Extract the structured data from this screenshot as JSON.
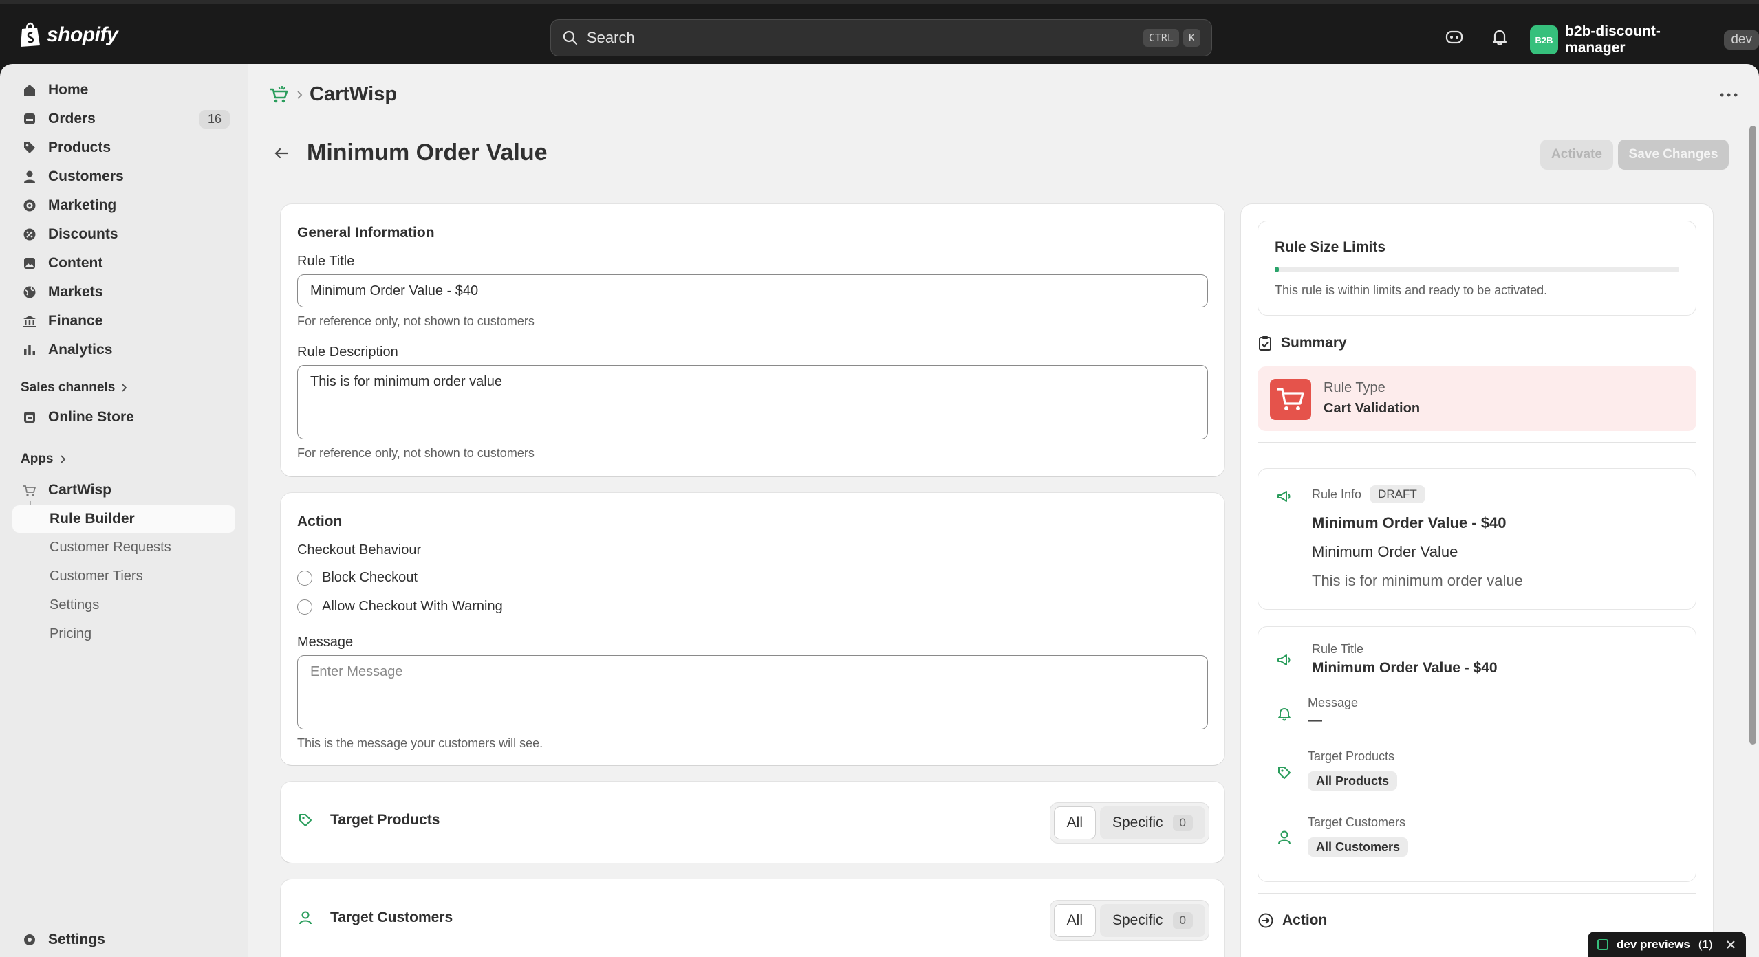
{
  "topbar": {
    "brand": "shopify",
    "search_placeholder": "Search",
    "kbd_ctrl": "CTRL",
    "kbd_k": "K",
    "store_avatar": "B2B",
    "store_name": "b2b-discount-manager",
    "store_badge": "dev"
  },
  "sidebar": {
    "items": [
      {
        "label": "Home",
        "icon": "home-icon"
      },
      {
        "label": "Orders",
        "icon": "orders-icon",
        "count": "16"
      },
      {
        "label": "Products",
        "icon": "tag-icon"
      },
      {
        "label": "Customers",
        "icon": "person-icon"
      },
      {
        "label": "Marketing",
        "icon": "target-icon"
      },
      {
        "label": "Discounts",
        "icon": "discount-icon"
      },
      {
        "label": "Content",
        "icon": "content-icon"
      },
      {
        "label": "Markets",
        "icon": "globe-icon"
      },
      {
        "label": "Finance",
        "icon": "bank-icon"
      },
      {
        "label": "Analytics",
        "icon": "chart-icon"
      }
    ],
    "sales_channels": "Sales channels",
    "online_store": "Online Store",
    "apps": "Apps",
    "app_name": "CartWisp",
    "app_subitems": [
      "Rule Builder",
      "Customer Requests",
      "Customer Tiers",
      "Settings",
      "Pricing"
    ],
    "settings": "Settings"
  },
  "main": {
    "app_title": "CartWisp",
    "page_title": "Minimum Order Value",
    "activate_label": "Activate",
    "save_label": "Save Changes",
    "general": {
      "heading": "General Information",
      "title_label": "Rule Title",
      "title_value": "Minimum Order Value - $40",
      "title_help": "For reference only, not shown to customers",
      "desc_label": "Rule Description",
      "desc_value": "This is for minimum order value",
      "desc_help": "For reference only, not shown to customers"
    },
    "action": {
      "heading": "Action",
      "checkout_label": "Checkout Behaviour",
      "option_block": "Block Checkout",
      "option_warn": "Allow Checkout With Warning",
      "message_label": "Message",
      "message_placeholder": "Enter Message",
      "message_help": "This is the message your customers will see."
    },
    "target_products": {
      "label": "Target Products",
      "all": "All",
      "specific": "Specific",
      "count": "0"
    },
    "target_customers": {
      "label": "Target Customers",
      "all": "All",
      "specific": "Specific",
      "count": "0"
    }
  },
  "right": {
    "limits_title": "Rule Size Limits",
    "limits_progress": 0.01,
    "limits_text": "This rule is within limits and ready to be activated.",
    "summary_title": "Summary",
    "rule_type_label": "Rule Type",
    "rule_type_value": "Cart Validation",
    "info_label": "Rule Info",
    "info_status": "DRAFT",
    "info_title": "Minimum Order Value - $40",
    "info_name": "Minimum Order Value",
    "info_desc": "This is for minimum order value",
    "rt_label": "Rule Title",
    "rt_value": "Minimum Order Value - $40",
    "msg_label": "Message",
    "msg_value": "—",
    "tp_label": "Target Products",
    "tp_value": "All Products",
    "tc_label": "Target Customers",
    "tc_value": "All Customers",
    "action_title": "Action"
  },
  "devbar": {
    "label": "dev previews",
    "count": "(1)"
  },
  "colors": {
    "accent_green": "#29a36a",
    "rule_type_bg": "#fdecec",
    "rule_type_icon": "#e5534b"
  }
}
